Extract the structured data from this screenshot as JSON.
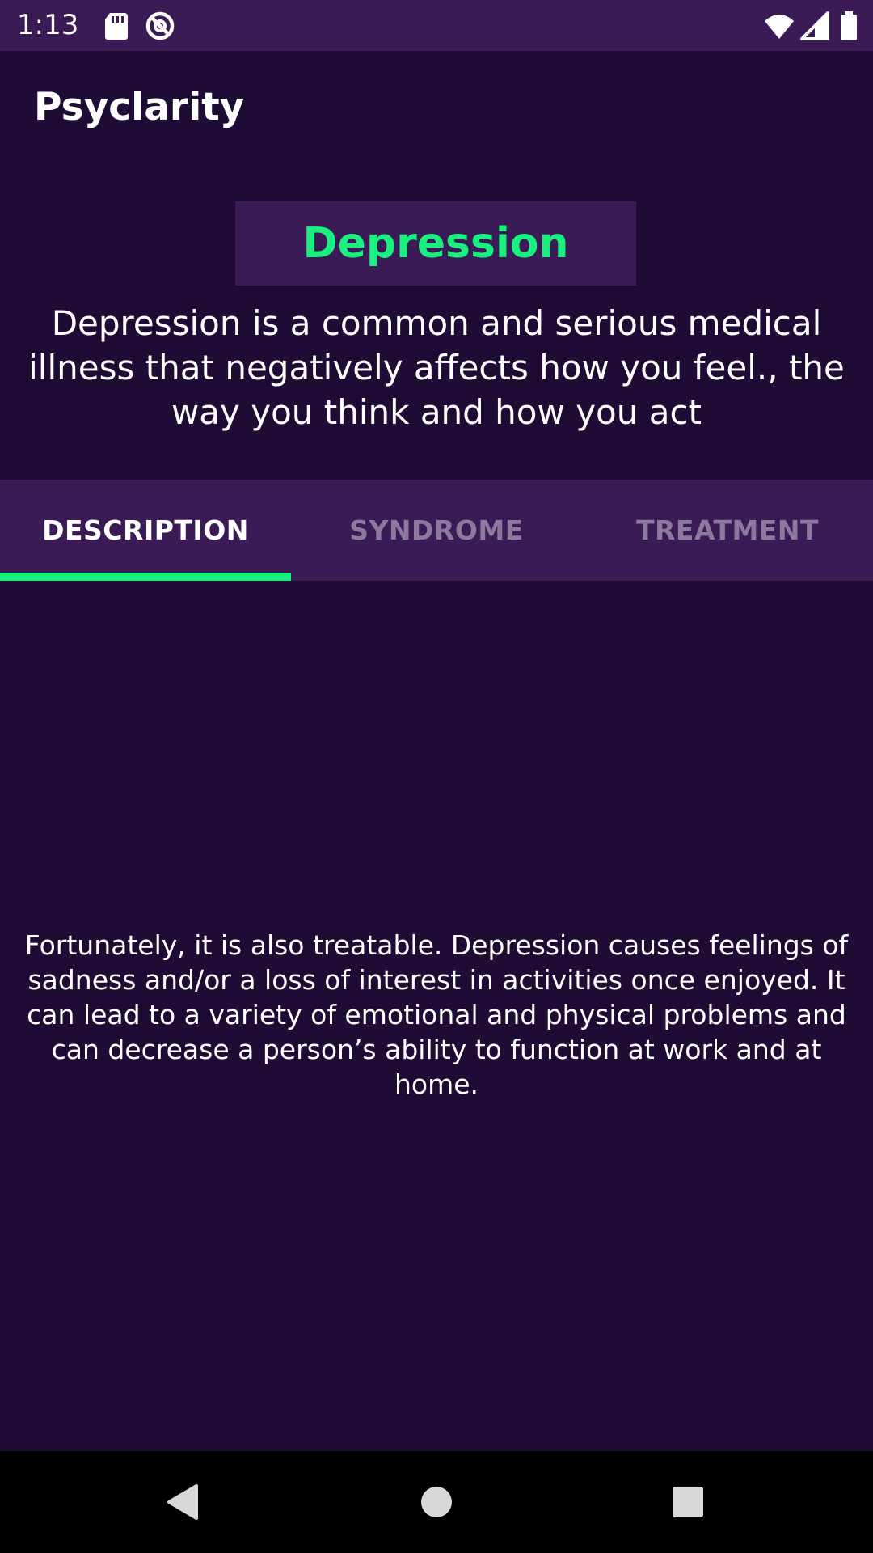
{
  "status_bar": {
    "time": "1:13",
    "icons": [
      "sd-card-icon",
      "no-disturb-icon",
      "wifi-icon",
      "signal-icon",
      "battery-icon"
    ]
  },
  "app_bar": {
    "title": "Psyclarity"
  },
  "topic": {
    "title": "Depression",
    "summary": "Depression is a common and serious medical illness that negatively affects how you feel., the way you think and how you act"
  },
  "tabs": [
    {
      "label": "DESCRIPTION",
      "active": true
    },
    {
      "label": "SYNDROME",
      "active": false
    },
    {
      "label": "TREATMENT",
      "active": false
    }
  ],
  "content": {
    "text": "Fortunately, it is also treatable. Depression causes feelings of sadness and/or a loss of interest in activities once enjoyed. It can lead to a variety of emotional and physical problems and can decrease a person’s ability to function at work and at home."
  },
  "nav_bar": {
    "icons": [
      "back-icon",
      "home-icon",
      "recents-icon"
    ]
  },
  "colors": {
    "background": "#1e0c35",
    "surface": "#3a1b55",
    "accent": "#19f07f",
    "inactive_tab": "#8b7a9e"
  }
}
